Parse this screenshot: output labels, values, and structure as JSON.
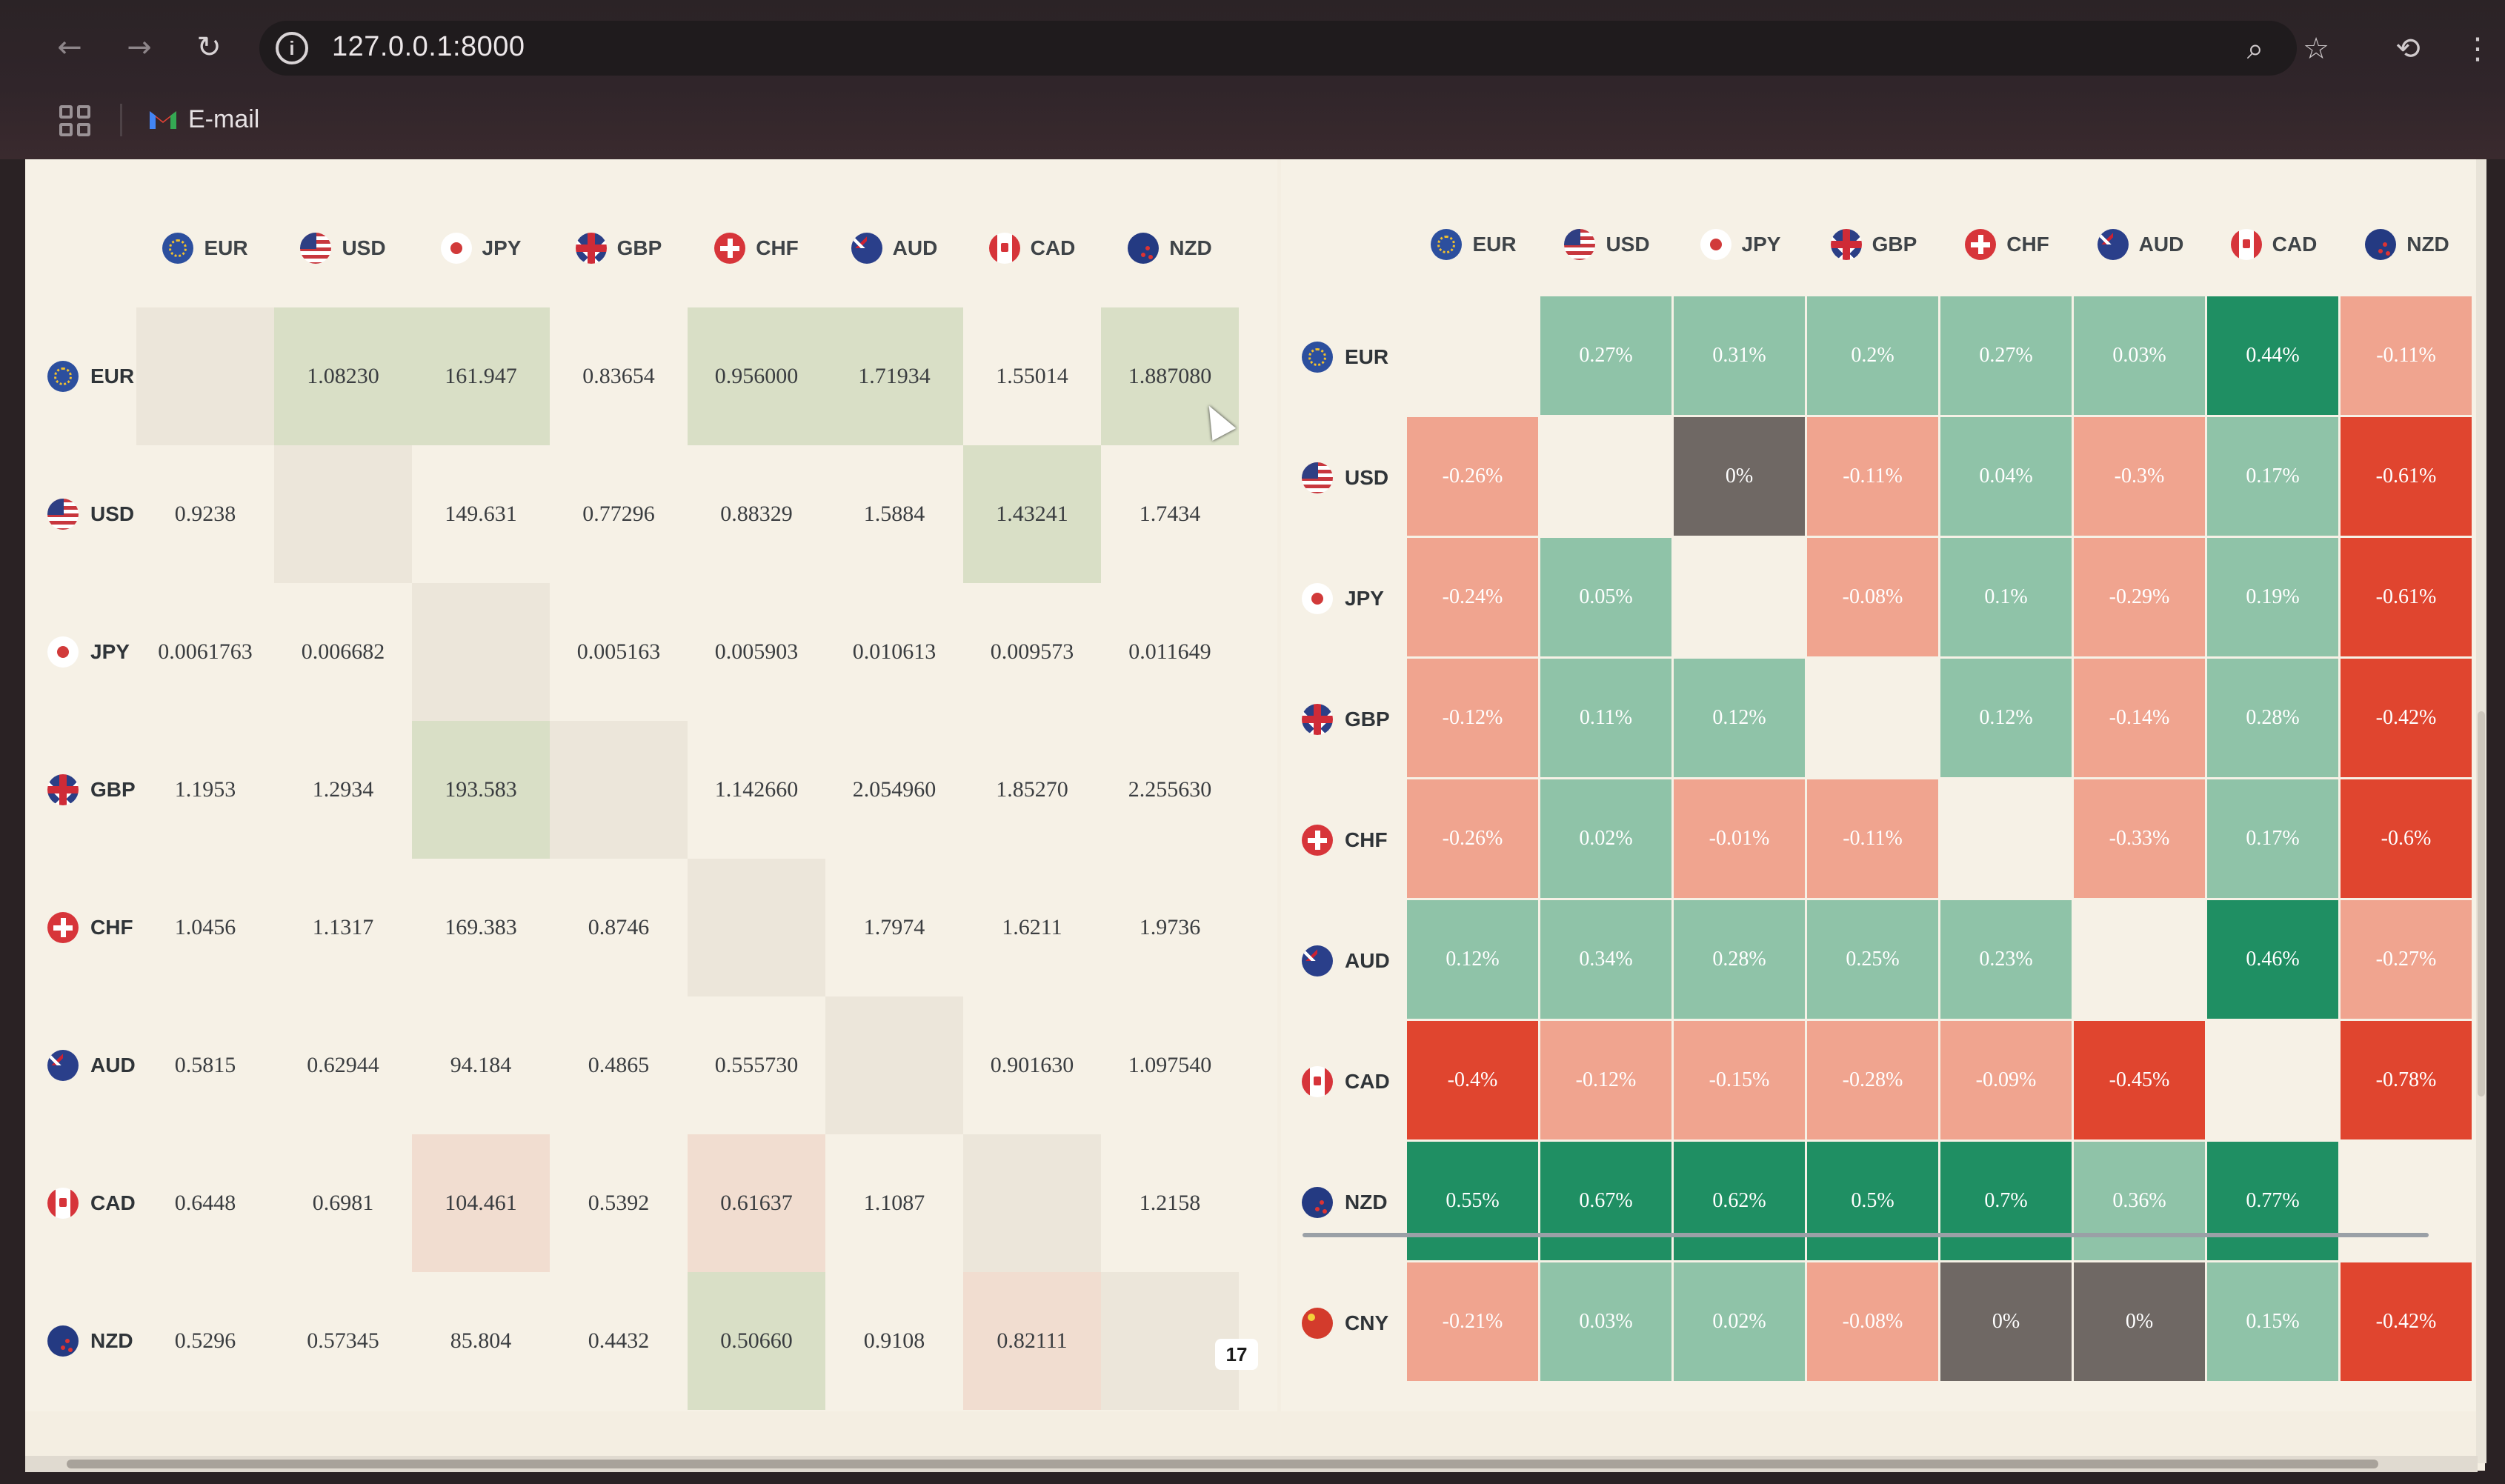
{
  "browser": {
    "url": "127.0.0.1:8000",
    "bookmark_label": "E-mail"
  },
  "cross_rates": {
    "columns": [
      "EUR",
      "USD",
      "JPY",
      "GBP",
      "CHF",
      "AUD",
      "CAD",
      "NZD"
    ],
    "rows": [
      {
        "code": "EUR",
        "values": [
          "",
          "1.08230",
          "161.947",
          "0.83654",
          "0.956000",
          "1.71934",
          "1.55014",
          "1.887080"
        ]
      },
      {
        "code": "USD",
        "values": [
          "0.9238",
          "",
          "149.631",
          "0.77296",
          "0.88329",
          "1.5884",
          "1.43241",
          "1.7434"
        ]
      },
      {
        "code": "JPY",
        "values": [
          "0.0061763",
          "0.006682",
          "",
          "0.005163",
          "0.005903",
          "0.010613",
          "0.009573",
          "0.011649"
        ]
      },
      {
        "code": "GBP",
        "values": [
          "1.1953",
          "1.2934",
          "193.583",
          "",
          "1.142660",
          "2.054960",
          "1.85270",
          "2.255630"
        ]
      },
      {
        "code": "CHF",
        "values": [
          "1.0456",
          "1.1317",
          "169.383",
          "0.8746",
          "",
          "1.7974",
          "1.6211",
          "1.9736"
        ]
      },
      {
        "code": "AUD",
        "values": [
          "0.5815",
          "0.62944",
          "94.184",
          "0.4865",
          "0.555730",
          "",
          "0.901630",
          "1.097540"
        ]
      },
      {
        "code": "CAD",
        "values": [
          "0.6448",
          "0.6981",
          "104.461",
          "0.5392",
          "0.61637",
          "1.1087",
          "",
          "1.2158"
        ]
      },
      {
        "code": "NZD",
        "values": [
          "0.5296",
          "0.57345",
          "85.804",
          "0.4432",
          "0.50660",
          "0.9108",
          "0.82111",
          ""
        ]
      }
    ],
    "logo_text": "17"
  },
  "heatmap": {
    "columns": [
      "EUR",
      "USD",
      "JPY",
      "GBP",
      "CHF",
      "AUD",
      "CAD",
      "NZD"
    ],
    "rows": [
      {
        "code": "EUR",
        "values": [
          "",
          "0.27%",
          "0.31%",
          "0.2%",
          "0.27%",
          "0.03%",
          "0.44%",
          "-0.11%"
        ]
      },
      {
        "code": "USD",
        "values": [
          "-0.26%",
          "",
          "0%",
          "-0.11%",
          "0.04%",
          "-0.3%",
          "0.17%",
          "-0.61%"
        ]
      },
      {
        "code": "JPY",
        "values": [
          "-0.24%",
          "0.05%",
          "",
          "-0.08%",
          "0.1%",
          "-0.29%",
          "0.19%",
          "-0.61%"
        ]
      },
      {
        "code": "GBP",
        "values": [
          "-0.12%",
          "0.11%",
          "0.12%",
          "",
          "0.12%",
          "-0.14%",
          "0.28%",
          "-0.42%"
        ]
      },
      {
        "code": "CHF",
        "values": [
          "-0.26%",
          "0.02%",
          "-0.01%",
          "-0.11%",
          "",
          "-0.33%",
          "0.17%",
          "-0.6%"
        ]
      },
      {
        "code": "AUD",
        "values": [
          "0.12%",
          "0.34%",
          "0.28%",
          "0.25%",
          "0.23%",
          "",
          "0.46%",
          "-0.27%"
        ]
      },
      {
        "code": "CAD",
        "values": [
          "-0.4%",
          "-0.12%",
          "-0.15%",
          "-0.28%",
          "-0.09%",
          "-0.45%",
          "",
          "-0.78%"
        ]
      },
      {
        "code": "NZD",
        "values": [
          "0.55%",
          "0.67%",
          "0.62%",
          "0.5%",
          "0.7%",
          "0.36%",
          "0.77%",
          ""
        ]
      },
      {
        "code": "CNY",
        "values": [
          "-0.21%",
          "0.03%",
          "0.02%",
          "-0.08%",
          "0%",
          "0%",
          "0.15%",
          "-0.42%"
        ]
      }
    ],
    "colors": {
      "positive_strong": "#1f8f63",
      "positive_light": "#8fc3a8",
      "negative_strong": "#e0452f",
      "negative_light": "#f0a48f",
      "zero": "#6f6864"
    }
  }
}
